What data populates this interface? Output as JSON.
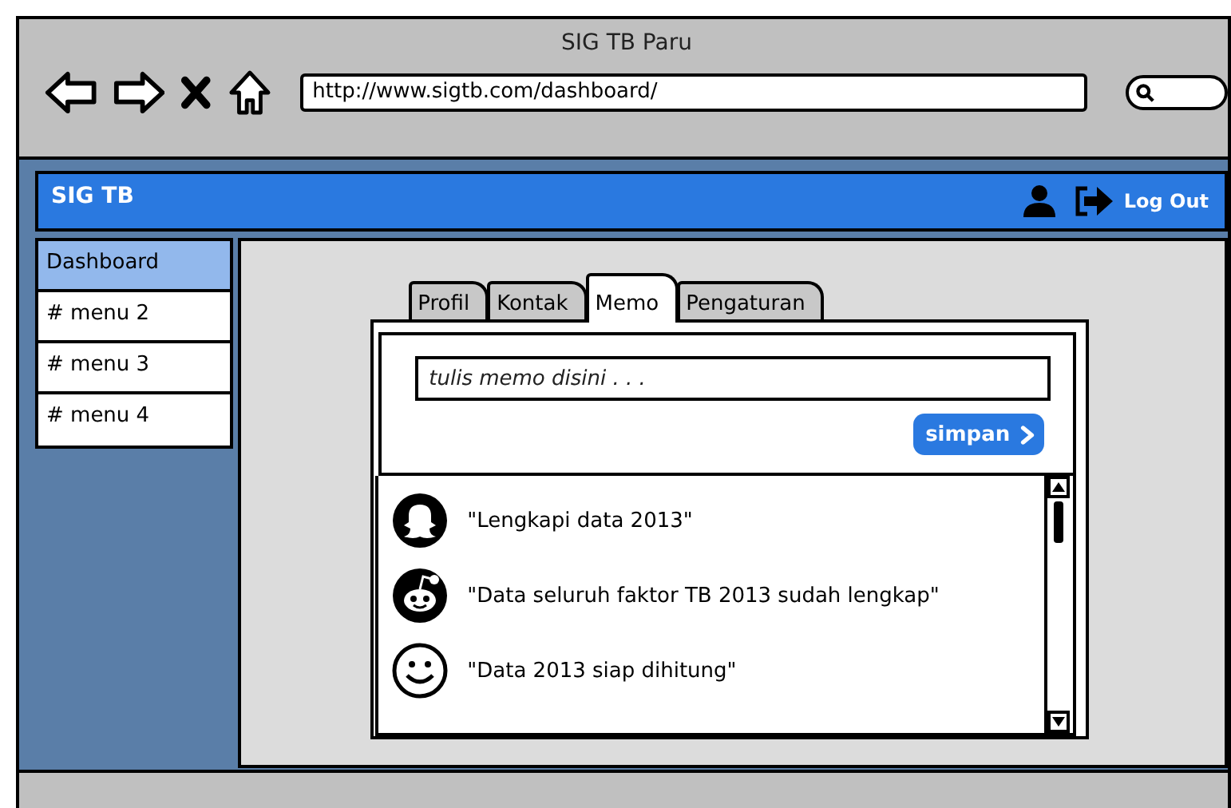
{
  "window": {
    "title": "SIG TB Paru"
  },
  "browser": {
    "url": "http://www.sigtb.com/dashboard/"
  },
  "header": {
    "app_name": "SIG TB",
    "logout": "Log Out"
  },
  "sidebar": {
    "items": [
      {
        "label": "Dashboard",
        "selected": true
      },
      {
        "label": "# menu 2",
        "selected": false
      },
      {
        "label": "# menu 3",
        "selected": false
      },
      {
        "label": "# menu 4",
        "selected": false
      }
    ]
  },
  "tabs": [
    {
      "label": "Profil",
      "selected": false
    },
    {
      "label": "Kontak",
      "selected": false
    },
    {
      "label": "Memo",
      "selected": true
    },
    {
      "label": "Pengaturan",
      "selected": false
    }
  ],
  "memo_form": {
    "placeholder": "tulis memo disini . . .",
    "button": "simpan"
  },
  "memos": [
    {
      "kind": "ghost",
      "text": "\"Lengkapi data 2013\""
    },
    {
      "kind": "robot",
      "text": "\"Data seluruh faktor TB 2013 sudah lengkap\""
    },
    {
      "kind": "smiley",
      "text": "\"Data 2013 siap dihitung\""
    }
  ]
}
